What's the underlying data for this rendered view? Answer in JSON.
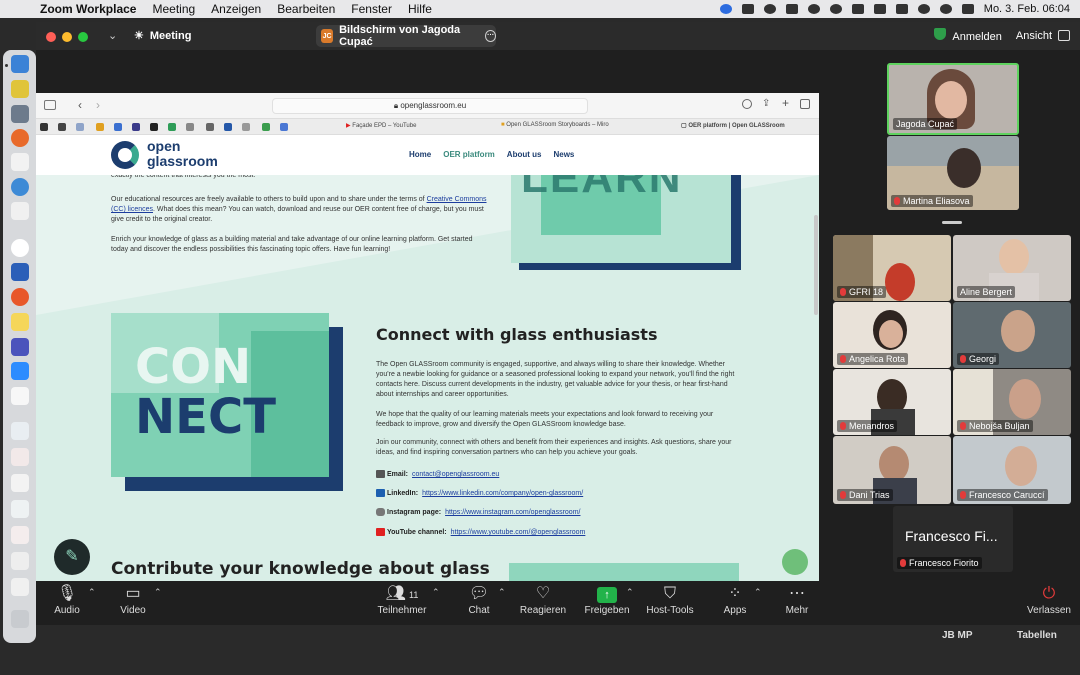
{
  "menubar": {
    "items": [
      "Zoom Workplace",
      "Meeting",
      "Anzeigen",
      "Bearbeiten",
      "Fenster",
      "Hilfe"
    ],
    "clock": "Mo. 3. Feb.  06:04"
  },
  "window": {
    "meeting_label": "Meeting",
    "share_initials": "JC",
    "share_title": "Bildschirm von Jagoda Cupać",
    "signin": "Anmelden",
    "view": "Ansicht"
  },
  "browser": {
    "url": "openglassroom.eu",
    "tabs": [
      "Façade EPD – YouTube",
      "Open GLASSroom Storyboards – Miro",
      "OER platform | Open GLASSroom"
    ]
  },
  "site": {
    "logo_line1": "open",
    "logo_line2": "glassroom",
    "nav": [
      "Home",
      "OER platform",
      "About us",
      "News"
    ],
    "intro_top": "exactly the content that interests you the most.",
    "para_cc_before": "Our educational resources are freely available to others to build upon and to share under the terms of",
    "para_cc_link": "Creative Commons (CC) licences",
    "para_cc_after": ". What does this mean? You can watch, download and reuse our OER content free of charge, but you must give credit to the original creator.",
    "para_enrich": "Enrich your knowledge of glass as a building material and take advantage of our online learning platform. Get started today and discover the endless possibilities this fascinating topic offers. Have fun learning!",
    "learn_graphic": "LEARN",
    "connect_graphic_1": "CON",
    "connect_graphic_2": "NECT",
    "connect_heading": "Connect with glass enthusiasts",
    "connect_p1": "The Open GLASSroom community is engaged, supportive, and always willing to share their knowledge. Whether you're a newbie looking for guidance or a seasoned professional looking to expand your network, you'll find the right contacts here. Discuss current developments in the industry, get valuable advice for your thesis, or hear first-hand about internships and career opportunities.",
    "connect_p2": "We hope that the quality of our learning materials meets your expectations and look forward to receiving your feedback to improve, grow and diversify the Open GLASSroom knowledge base.",
    "connect_p3": "Join our community, connect with others and benefit from their experiences and insights. Ask questions, share your ideas, and find inspiring conversation partners who can help you achieve your goals.",
    "contacts": [
      {
        "label": "Email:",
        "value": "contact@openglassroom.eu",
        "color": "#555555"
      },
      {
        "label": "LinkedIn:",
        "value": "https://www.linkedin.com/company/open-glassroom/",
        "color": "#1c5fb0"
      },
      {
        "label": "Instagram page:",
        "value": "https://www.instagram.com/openglassroom/",
        "color": "#555555"
      },
      {
        "label": "YouTube channel:",
        "value": "https://www.youtube.com/@openglassroom",
        "color": "#e02020"
      }
    ],
    "contribute_heading": "Contribute your knowledge about glass"
  },
  "participants": {
    "speaker_top": "Jagoda Cupać",
    "speaker_2": "Martina Eliasova",
    "grid": [
      "GFRI 18",
      "Aline Bergert",
      "Angelica Rota",
      "Georgi",
      "Menandros",
      "Nebojša Buljan",
      "Dani Trias",
      "Francesco Caruccí"
    ],
    "name_tile_big": "Francesco Fi...",
    "name_tile_small": "Francesco Fiorito"
  },
  "toolbar": {
    "audio": "Audio",
    "video": "Video",
    "participants": "Teilnehmer",
    "participant_count": "11",
    "chat": "Chat",
    "react": "Reagieren",
    "share": "Freigeben",
    "host_tools": "Host-Tools",
    "apps": "Apps",
    "more": "Mehr",
    "leave": "Verlassen"
  },
  "below_window": {
    "left": "JB MP",
    "right": "Tabellen"
  }
}
